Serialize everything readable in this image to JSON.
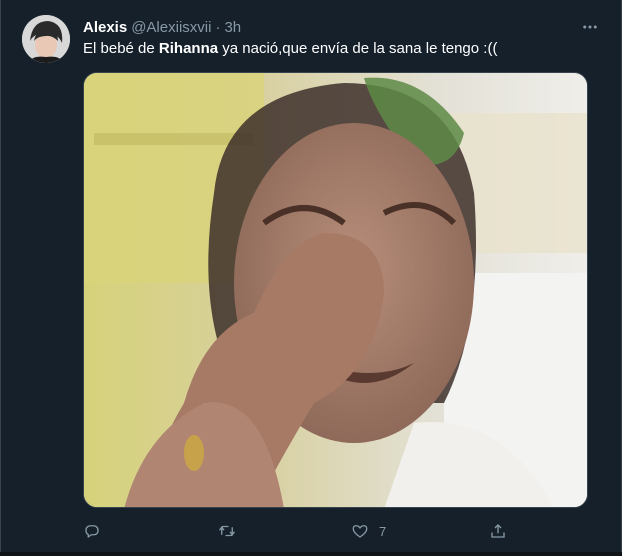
{
  "tweet": {
    "author_name": "Alexis",
    "author_handle": "@Alexiisxvii",
    "separator": "·",
    "time": "3h",
    "text_before": "El bebé de ",
    "text_bold": "Rihanna",
    "text_after": " ya nació,que envía de la sana le tengo :(("
  },
  "actions": {
    "like_count": "7"
  },
  "icons": {
    "more": "more-icon",
    "reply": "reply-icon",
    "retweet": "retweet-icon",
    "like": "heart-icon",
    "share": "share-icon"
  },
  "colors": {
    "background": "#15202b",
    "secondary_text": "#8899a6",
    "primary_text": "#ffffff"
  }
}
